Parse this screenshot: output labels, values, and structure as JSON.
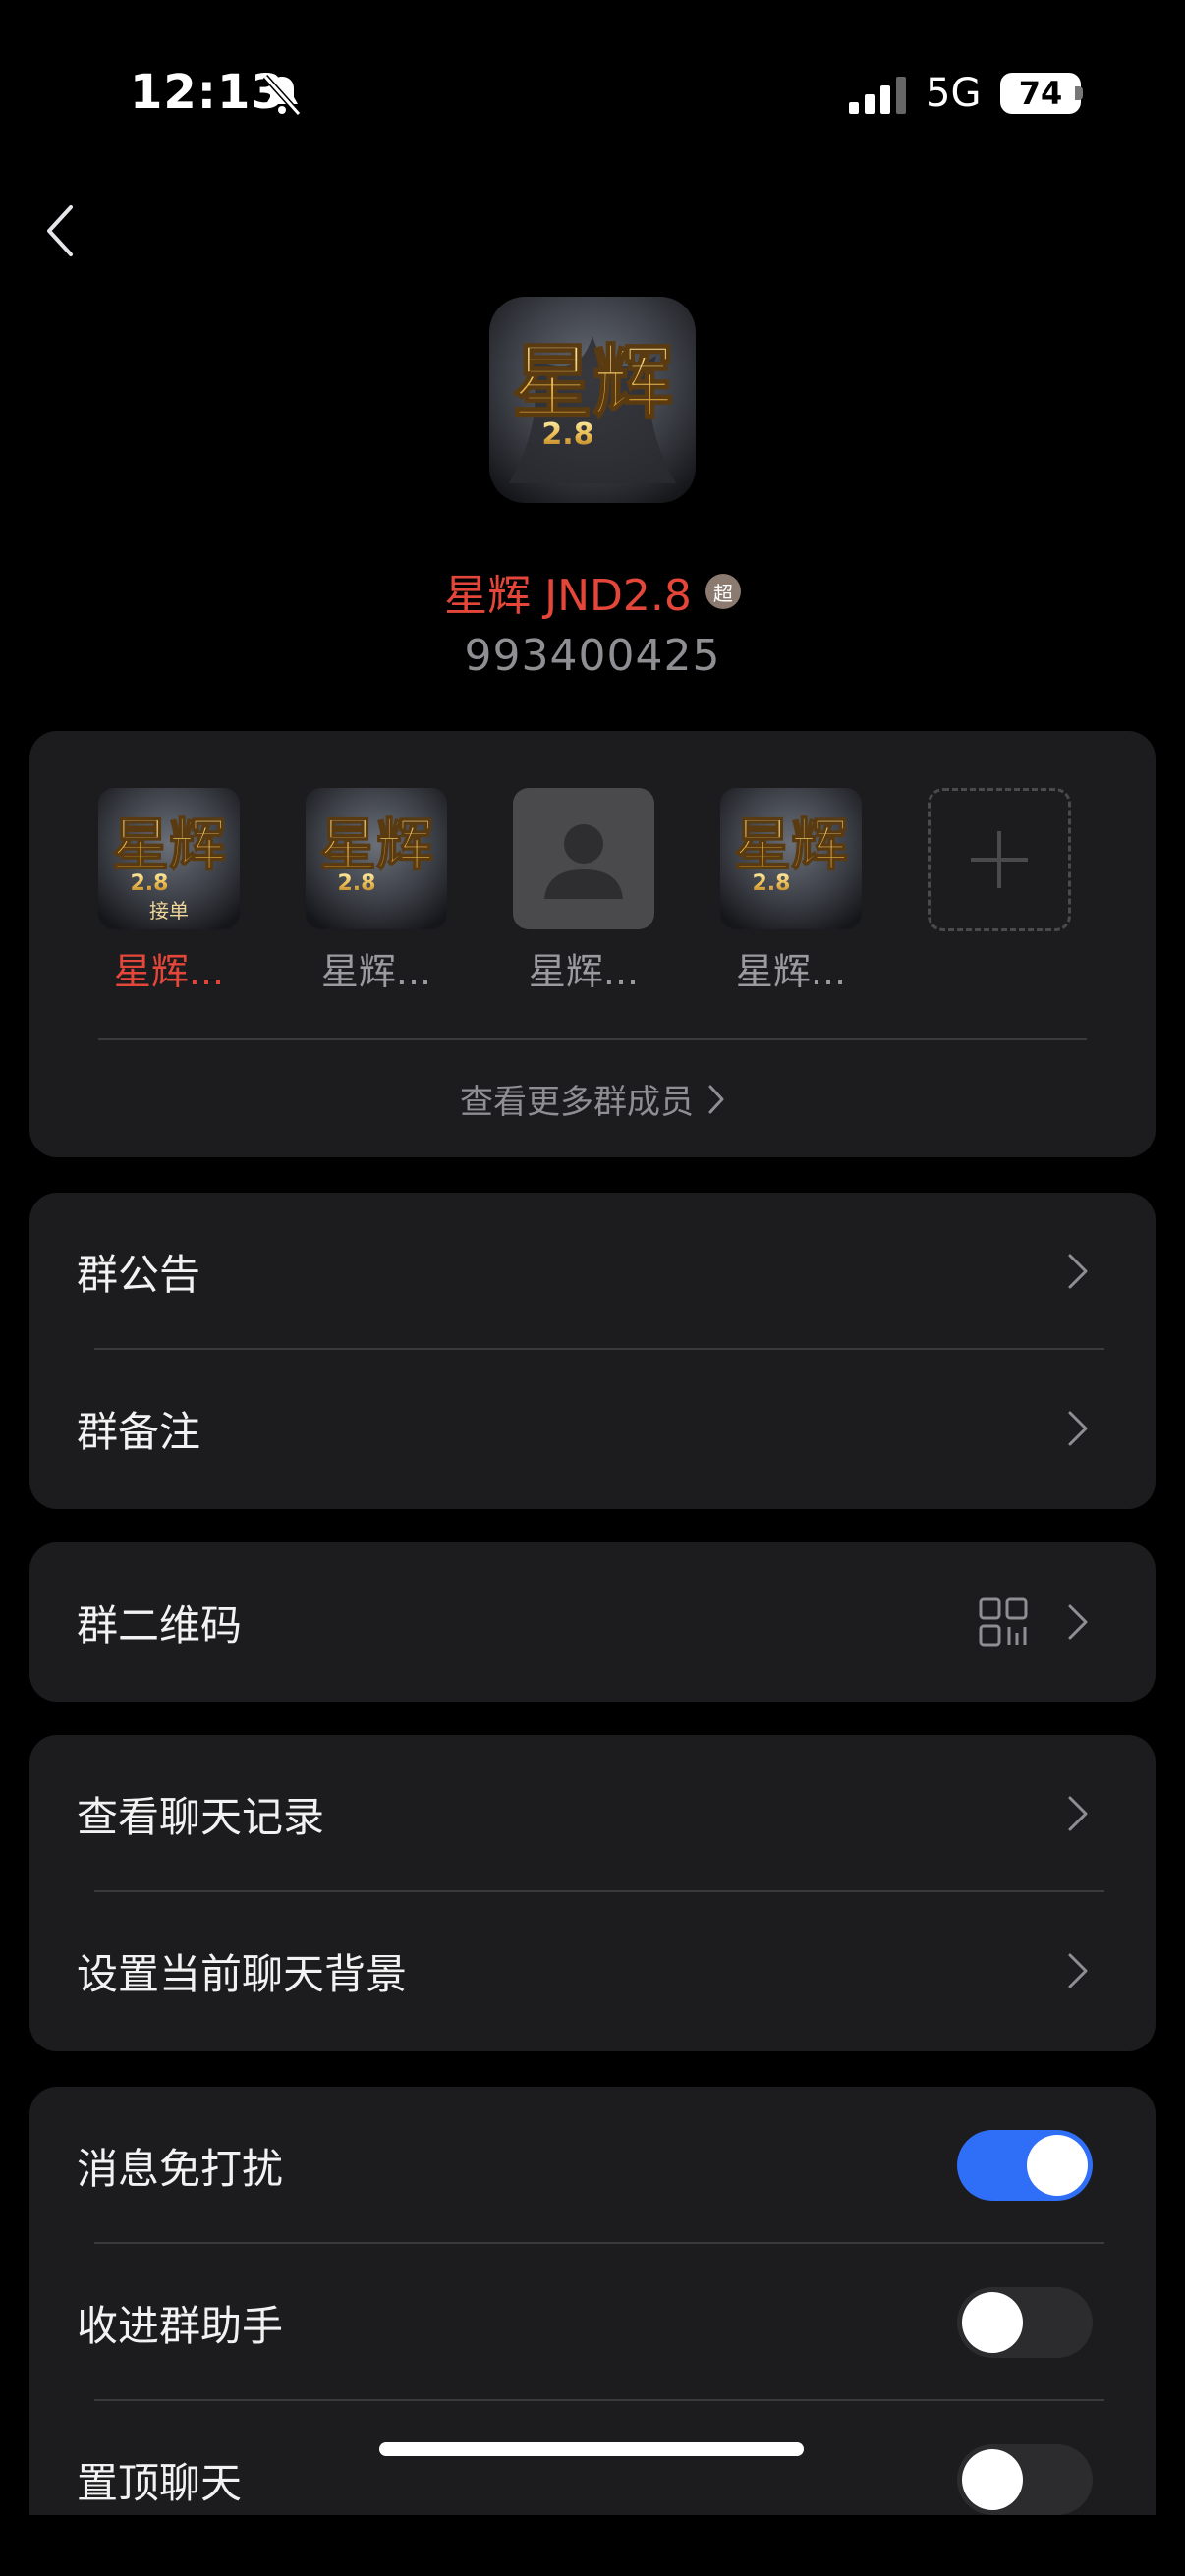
{
  "status_bar": {
    "time": "12:13",
    "network": "5G",
    "battery": "74"
  },
  "group": {
    "name": "星辉 JND2.8",
    "badge": "超",
    "id": "993400425",
    "avatar_text": "星辉",
    "avatar_sub": "2.8"
  },
  "members": {
    "items": [
      {
        "label": "星辉...",
        "highlight": true,
        "avatar_text": "星辉",
        "avatar_sub": "2.8",
        "tag": "接单"
      },
      {
        "label": "星辉...",
        "highlight": false,
        "avatar_text": "星辉",
        "avatar_sub": "2.8"
      },
      {
        "label": "星辉...",
        "highlight": false,
        "placeholder": true
      },
      {
        "label": "星辉...",
        "highlight": false,
        "avatar_text": "星辉",
        "avatar_sub": "2.8"
      }
    ],
    "more_label": "查看更多群成员"
  },
  "settings": {
    "announcement": "群公告",
    "remark": "群备注",
    "qrcode": "群二维码",
    "chat_history": "查看聊天记录",
    "chat_background": "设置当前聊天背景",
    "do_not_disturb": {
      "label": "消息免打扰",
      "on": true
    },
    "fold_to_assistant": {
      "label": "收进群助手",
      "on": false
    },
    "pin_chat": {
      "label": "置顶聊天",
      "on": false
    }
  },
  "colors": {
    "accent": "#2f6ef6",
    "name_red": "#e5463a",
    "card_bg": "#1c1c1e"
  }
}
